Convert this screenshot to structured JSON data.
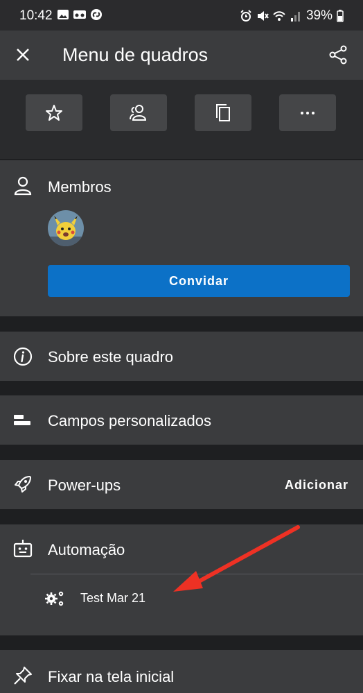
{
  "status": {
    "time": "10:42",
    "battery": "39%"
  },
  "header": {
    "title": "Menu de quadros"
  },
  "actions": [
    {
      "icon": "star-icon"
    },
    {
      "icon": "members-icon"
    },
    {
      "icon": "copy-icon"
    },
    {
      "icon": "more-icon"
    }
  ],
  "members": {
    "title": "Membros",
    "invite_label": "Convidar"
  },
  "about": {
    "label": "Sobre este quadro"
  },
  "custom_fields": {
    "label": "Campos personalizados"
  },
  "powerups": {
    "label": "Power-ups",
    "action": "Adicionar"
  },
  "automation": {
    "label": "Automação",
    "items": [
      {
        "label": "Test Mar 21"
      }
    ]
  },
  "pin": {
    "label": "Fixar na tela inicial"
  }
}
